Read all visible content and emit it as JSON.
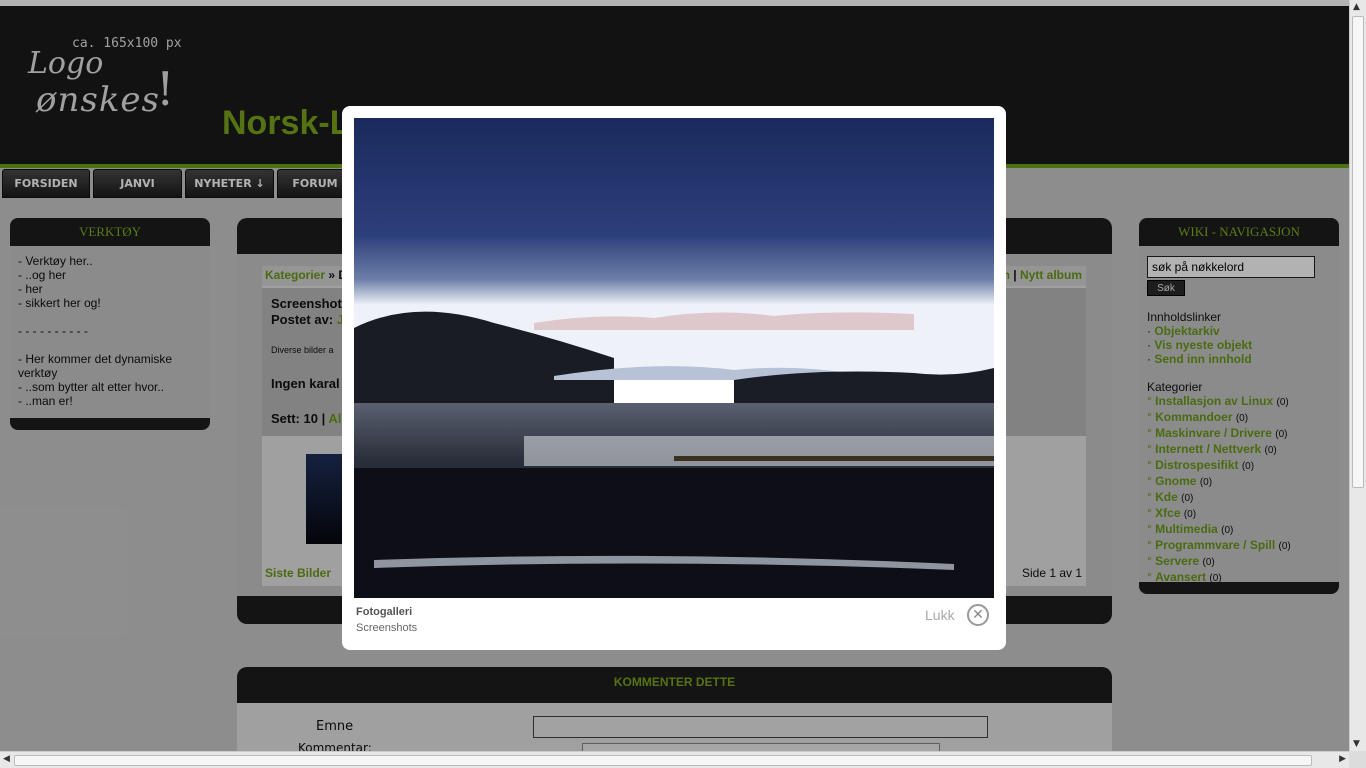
{
  "header": {
    "logo_size_note": "ca. 165x100 px",
    "logo_line1": "Logo",
    "logo_line2": "ønskes",
    "logo_mark": "!",
    "site_title": "Norsk-L"
  },
  "nav": {
    "items": [
      {
        "label": "FORSIDEN"
      },
      {
        "label": "JANVI"
      },
      {
        "label": "NYHETER ↓"
      },
      {
        "label": "FORUM ↓"
      }
    ]
  },
  "left_panel": {
    "title": "VERKTØY",
    "lines": [
      "- Verktøy her..",
      "- ..og her",
      "- her",
      "- sikkert her og!",
      "",
      "- - - - - - - - - -",
      "",
      "- Her kommer det dynamiske",
      "verktøy",
      "- ..som bytter alt etter hvor..",
      "- ..man er!"
    ]
  },
  "right_panel": {
    "title": "WIKI - NAVIGASJON",
    "search_placeholder": "søk på nøkkelord",
    "search_button": "Søk",
    "content_links_title": "Innholdslinker",
    "content_links": [
      "Objektarkiv",
      "Vis nyeste objekt",
      "Send inn innhold"
    ],
    "categories_title": "Kategorier",
    "categories": [
      {
        "label": "Installasjon av Linux",
        "count": "(0)"
      },
      {
        "label": "Kommandoer",
        "count": "(0)"
      },
      {
        "label": "Maskinvare / Drivere",
        "count": "(0)"
      },
      {
        "label": "Internett / Nettverk",
        "count": "(0)"
      },
      {
        "label": "Distrospesifikt",
        "count": "(0)"
      },
      {
        "label": "Gnome",
        "count": "(0)"
      },
      {
        "label": "Kde",
        "count": "(0)"
      },
      {
        "label": "Xfce",
        "count": "(0)"
      },
      {
        "label": "Multimedia",
        "count": "(0)"
      },
      {
        "label": "Programmvare / Spill",
        "count": "(0)"
      },
      {
        "label": "Servere",
        "count": "(0)"
      },
      {
        "label": "Avansert",
        "count": "(0)"
      }
    ]
  },
  "gallery": {
    "crumb_left": "Kategorier",
    "crumb_sep": " » D",
    "crumb_right_a": "n",
    "crumb_right_sep": " | ",
    "crumb_right_b": "Nytt album",
    "album_title": "Screenshot",
    "posted_by": "Postet av:",
    "posted_by_name": "J",
    "description": "Diverse bilder a",
    "no_rating": "Ingen karal",
    "views": "Sett: 10",
    "views_sep": " | ",
    "views_link": "Al",
    "last_pics": "Siste Bilder",
    "page_info": "Side 1 av 1"
  },
  "comment": {
    "title": "KOMMENTER DETTE",
    "subject_label": "Emne",
    "comment_label": "Kommentar:"
  },
  "lightbox": {
    "title": "Fotogalleri",
    "subtitle": "Screenshots",
    "close_label": "Lukk",
    "close_glyph": "✕"
  },
  "colors": {
    "accent_green": "#7aa51a",
    "header_bg": "#1b1b1b"
  }
}
